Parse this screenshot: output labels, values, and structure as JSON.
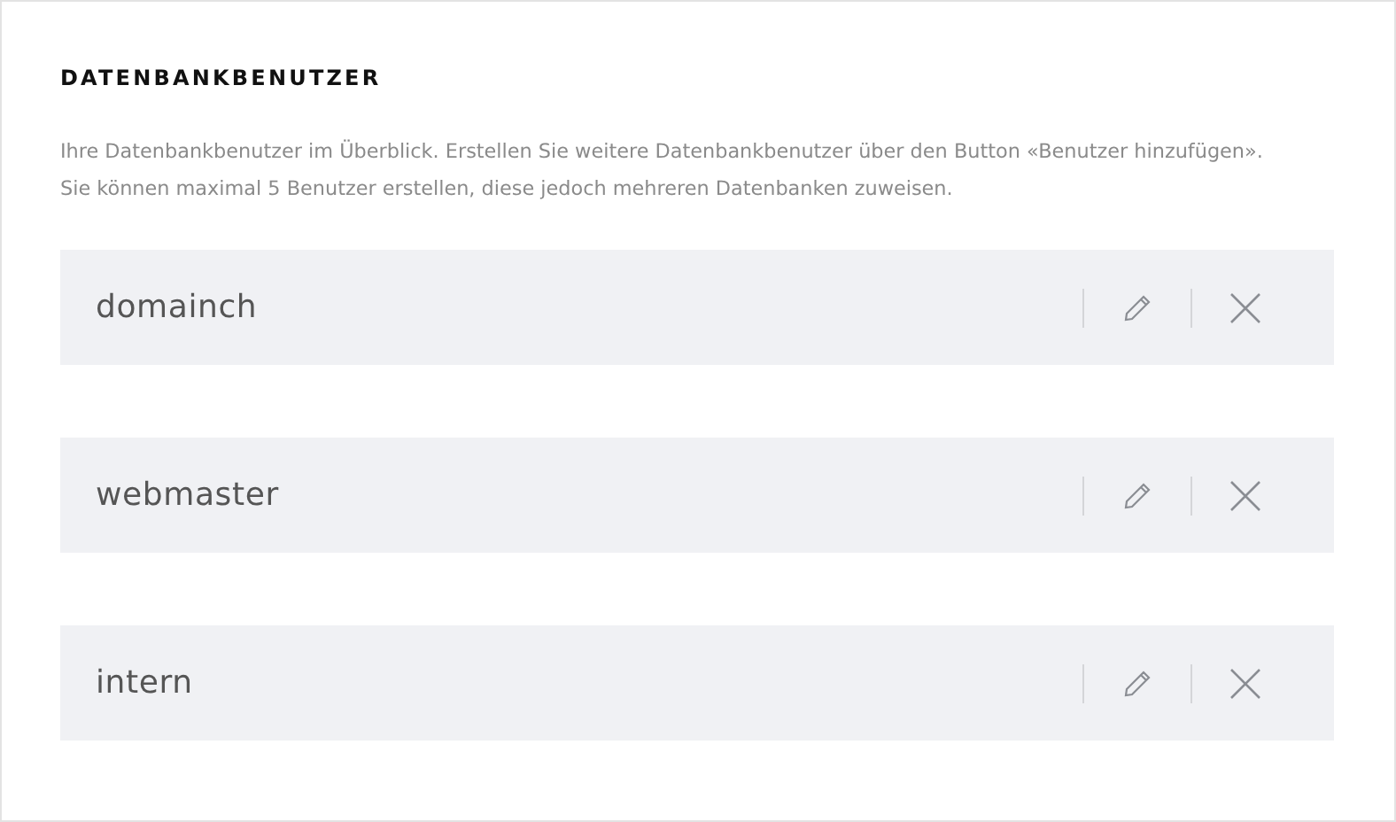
{
  "section": {
    "title": "DATENBANKBENUTZER",
    "description": "Ihre Datenbankbenutzer im Überblick. Erstellen Sie weitere Datenbankbenutzer über den Button «Benutzer hinzufügen». Sie können maximal 5 Benutzer erstellen, diese jedoch mehreren Datenbanken zuweisen."
  },
  "users": [
    {
      "name": "domainch"
    },
    {
      "name": "webmaster"
    },
    {
      "name": "intern"
    }
  ]
}
